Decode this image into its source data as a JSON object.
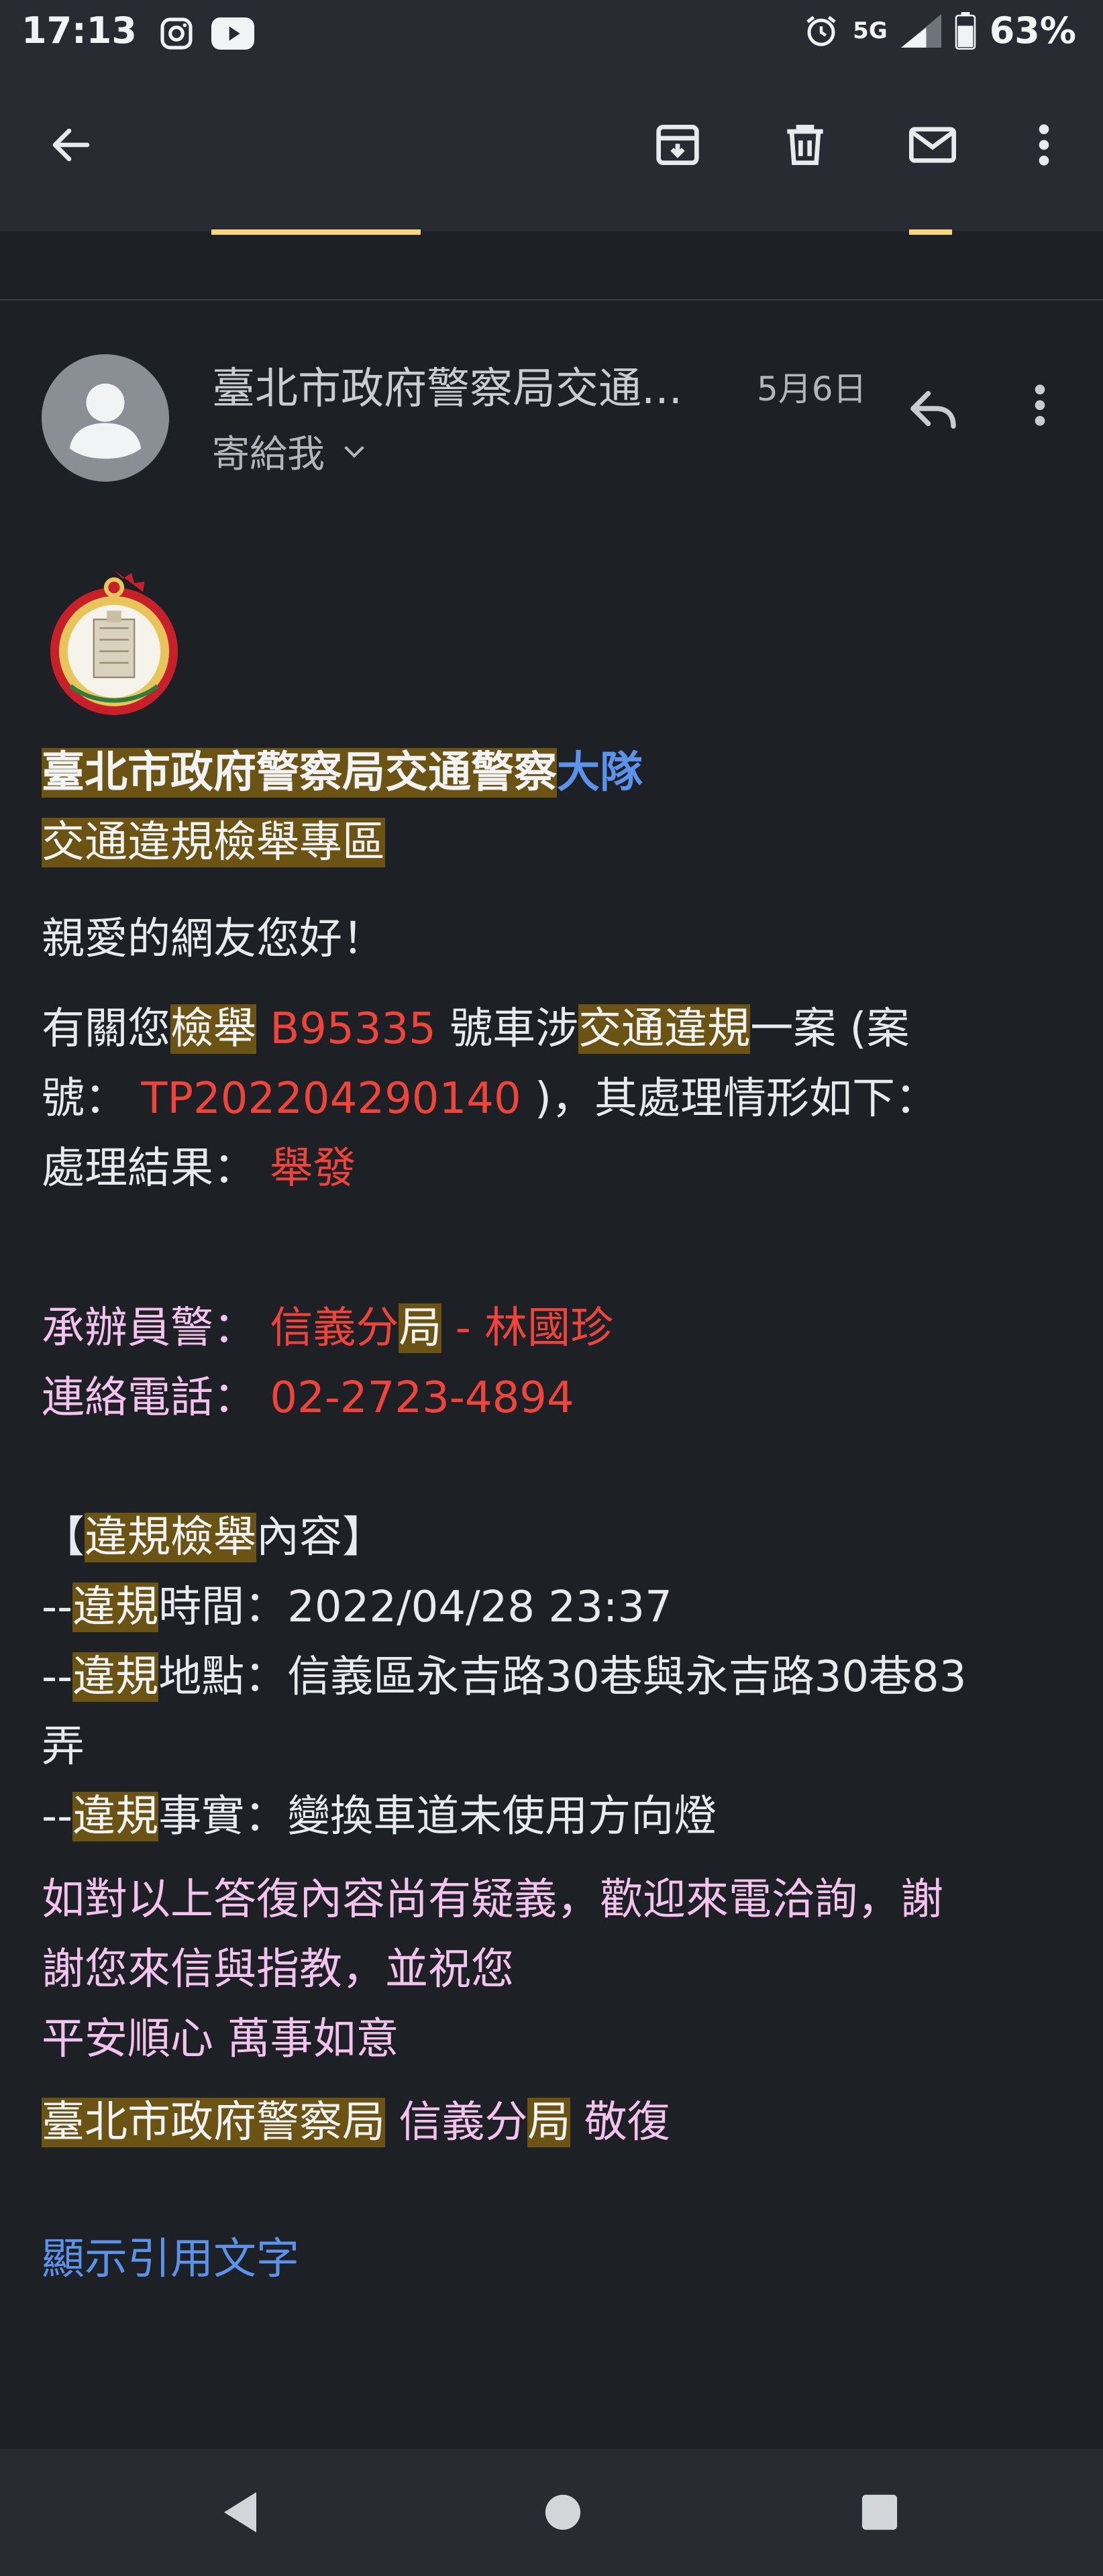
{
  "status_bar": {
    "time": "17:13",
    "network": "5G",
    "battery": "63%",
    "icons": [
      "instagram-icon",
      "youtube-icon",
      "alarm-icon",
      "signal-icon",
      "battery-icon"
    ]
  },
  "toolbar": {
    "icons": [
      "back-arrow-icon",
      "archive-icon",
      "delete-icon",
      "mark-unread-icon",
      "more-vert-icon"
    ]
  },
  "email": {
    "sender": "臺北市政府警察局交通...",
    "date": "5月6日",
    "recipient": "寄給我",
    "header": {
      "org": "臺北市政府警察局交通警察",
      "unit": "大隊",
      "section": "交通違規檢舉專區"
    },
    "greeting": "親愛的網友您好！",
    "body": {
      "p1_a": "有關您",
      "p1_b": "檢舉",
      "p1_plate": "B95335",
      "p1_c": "號車涉",
      "p1_d": "交通違規",
      "p1_e": "一案 (案",
      "p1_f": "號：",
      "p1_case": "TP202204290140",
      "p1_g": ")，其處理情形如下：",
      "result_label": "處理結果：",
      "result_value": "舉發"
    },
    "officer": {
      "label": "承辦員警：",
      "station_a": "信義分",
      "station_b": "局",
      "name": "- 林國珍",
      "phone_label": "連絡電話：",
      "phone": "02-2723-4894"
    },
    "violation": {
      "open": "【",
      "title_hl": "違規檢舉",
      "title_rest": "內容】",
      "dash": "--",
      "hl": "違規",
      "time_label": "時間：",
      "time": "2022/04/28 23:37",
      "place_label": "地點：",
      "place_1": "信義區永吉路30巷與永吉路30巷83",
      "place_2": "弄",
      "fact_label": "事實：",
      "fact": "變換車道未使用方向燈"
    },
    "closing": {
      "line1": "如對以上答復內容尚有疑義，歡迎來電洽詢，謝",
      "line2": "謝您來信與指教，並祝您",
      "line3": "平安順心 萬事如意"
    },
    "signature": {
      "org": "臺北市政府警察局",
      "station_a": "信義分",
      "station_b": "局",
      "end": "敬復"
    },
    "show_quoted": "顯示引用文字"
  },
  "nav_bar": {
    "icons": [
      "nav-back-icon",
      "nav-home-icon",
      "nav-recents-icon"
    ]
  }
}
